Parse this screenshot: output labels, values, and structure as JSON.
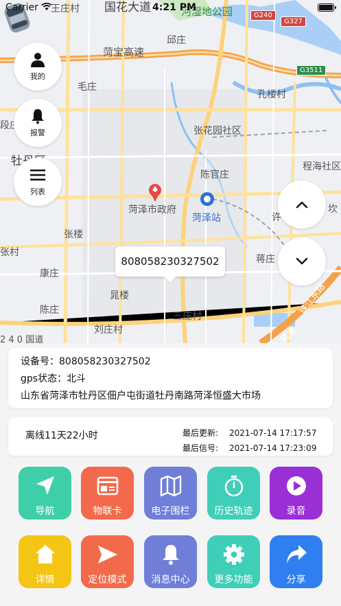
{
  "status_bar": {
    "carrier": "Carrier",
    "time": "4:21 PM"
  },
  "map": {
    "labels": {
      "wangzhuang": "王庄村",
      "guohua": "国花大道",
      "wetland": "河湿地公园",
      "qiuzhuang": "邱庄",
      "hebao": "菏宝高速",
      "maozhuang": "毛庄",
      "kongloucun": "孔楼村",
      "duanzhuang": "段庄",
      "zhangxianyuan": "张花园社区",
      "mudanqu": "牡丹区",
      "chenguanzhuang": "陈官庄",
      "chenghai": "程海社区",
      "government": "菏泽市政府",
      "heze_station": "菏泽站",
      "kan": "坎",
      "zhanglou": "张楼",
      "xu": "许",
      "zhangcun": "张村",
      "jiangzhuang": "蒋庄",
      "kangzhuang": "康庄",
      "huanglou": "晁楼",
      "chenzhuang": "陈庄",
      "xiaozhuangcun": "三庄村",
      "liuzhuangcun": "刘庄村",
      "guodao": "2 4 0 国道",
      "zhujiang": "珠江东路",
      "gaosu": "高速"
    },
    "shields": {
      "g240": "G240",
      "g327": "G327",
      "g3511": "G3511"
    },
    "callout": "808058230327502"
  },
  "side_buttons": {
    "mine": "我的",
    "alarm": "报警",
    "list": "列表"
  },
  "device_info": {
    "device_label": "设备号：",
    "device_id": "808058230327502",
    "gps_label": "gps状态：",
    "gps_value": "北斗",
    "address": "山东省菏泽市牡丹区佃户屯街道牡丹南路菏泽恒盛大市场"
  },
  "status_card": {
    "offline": "离线11天22小时",
    "last_update_label": "最后更新:",
    "last_update_value": "2021-07-14 17:17:57",
    "last_signal_label": "最后信号:",
    "last_signal_value": "2021-07-14 17:23:09"
  },
  "features": [
    {
      "label": "导航",
      "icon": "navigation-arrow-icon",
      "color": "#3fcfa8"
    },
    {
      "label": "物联卡",
      "icon": "sim-card-icon",
      "color": "#f26a4b"
    },
    {
      "label": "电子围栏",
      "icon": "map-fence-icon",
      "color": "#6f7fd8"
    },
    {
      "label": "历史轨迹",
      "icon": "stopwatch-icon",
      "color": "#3fcfb8"
    },
    {
      "label": "录音",
      "icon": "record-play-icon",
      "color": "#9b2fd6"
    },
    {
      "label": "详情",
      "icon": "home-icon",
      "color": "#f5c516"
    },
    {
      "label": "定位模式",
      "icon": "send-icon",
      "color": "#f26a4b"
    },
    {
      "label": "消息中心",
      "icon": "bell-icon",
      "color": "#6f7fd8"
    },
    {
      "label": "更多功能",
      "icon": "gear-icon",
      "color": "#3fcfb8"
    },
    {
      "label": "分享",
      "icon": "share-icon",
      "color": "#2f7ff0"
    }
  ]
}
